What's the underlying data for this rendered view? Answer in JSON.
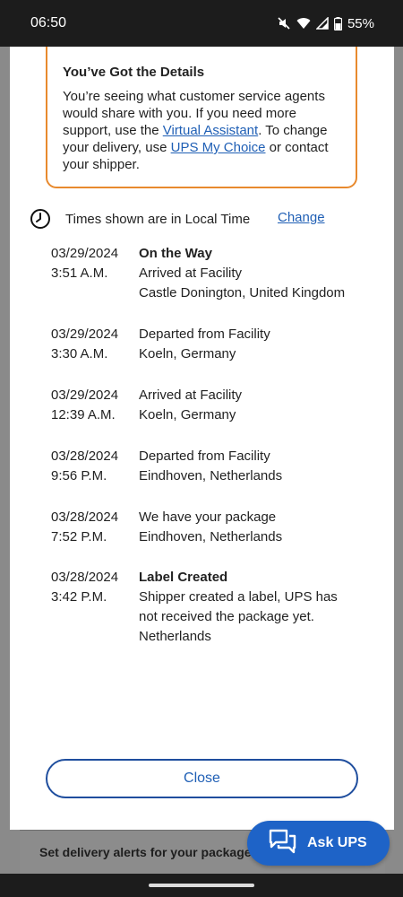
{
  "status_bar": {
    "time": "06:50",
    "battery": "55%",
    "icons": [
      "mute-icon",
      "wifi-icon",
      "signal-icon",
      "battery-icon"
    ]
  },
  "info_box": {
    "title": "You’ve Got the Details",
    "text_1": "You’re seeing what customer service agents would share with you. If you need more support, use the ",
    "link_1": "Virtual Assistant",
    "text_2": ". To change your delivery, use ",
    "link_2": "UPS My Choice",
    "text_3": " or contact your shipper."
  },
  "local_time": {
    "text": "Times shown are in Local Time",
    "change_label": "Change"
  },
  "events": [
    {
      "date": "03/29/2024",
      "time": "3:51 A.M.",
      "status": "On the Way",
      "lines": [
        "Arrived at Facility",
        "Castle Donington, United Kingdom"
      ]
    },
    {
      "date": "03/29/2024",
      "time": "3:30 A.M.",
      "status": "",
      "lines": [
        "Departed from Facility",
        "Koeln, Germany"
      ]
    },
    {
      "date": "03/29/2024",
      "time": "12:39 A.M.",
      "status": "",
      "lines": [
        "Arrived at Facility",
        "Koeln, Germany"
      ]
    },
    {
      "date": "03/28/2024",
      "time": "9:56 P.M.",
      "status": "",
      "lines": [
        "Departed from Facility",
        "Eindhoven, Netherlands"
      ]
    },
    {
      "date": "03/28/2024",
      "time": "7:52 P.M.",
      "status": "",
      "lines": [
        "We have your package",
        "Eindhoven, Netherlands"
      ]
    },
    {
      "date": "03/28/2024",
      "time": "3:42 P.M.",
      "status": "Label Created",
      "lines": [
        "Shipper created a label, UPS has",
        "not received the package yet.",
        "Netherlands"
      ]
    }
  ],
  "close_label": "Close",
  "ask_ups_label": "Ask UPS",
  "background": {
    "alerts_text": "Set delivery alerts for your package"
  },
  "colors": {
    "accent_orange": "#e88a2e",
    "link_blue": "#1f5fb5",
    "ask_button_blue": "#1e63c7"
  }
}
